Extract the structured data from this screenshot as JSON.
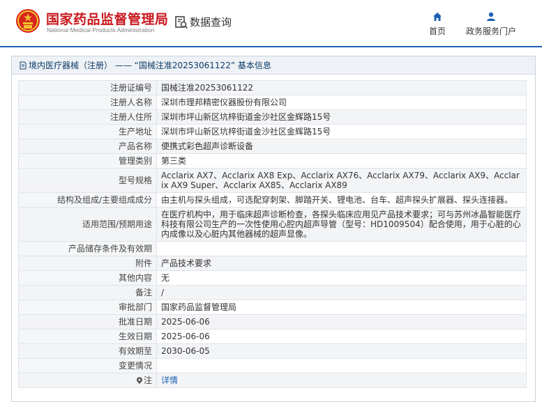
{
  "header": {
    "brand_cn": "国家药品监督管理局",
    "brand_en": "National Medical Products Administration",
    "query_label": "数据查询",
    "nav": [
      {
        "label": "首页",
        "icon": "home-icon"
      },
      {
        "label": "政务服务门户",
        "icon": "user-icon"
      }
    ]
  },
  "panel": {
    "title": "境内医疗器械（注册） —— “国械注准20253061122” 基本信息"
  },
  "rows": [
    {
      "label": "注册证编号",
      "value": "国械注准20253061122"
    },
    {
      "label": "注册人名称",
      "value": "深圳市理邦精密仪器股份有限公司"
    },
    {
      "label": "注册人住所",
      "value": "深圳市坪山新区坑梓街道金沙社区金辉路15号"
    },
    {
      "label": "生产地址",
      "value": "深圳市坪山新区坑梓街道金沙社区金辉路15号"
    },
    {
      "label": "产品名称",
      "value": "便携式彩色超声诊断设备"
    },
    {
      "label": "管理类别",
      "value": "第三类"
    },
    {
      "label": "型号规格",
      "value": "Acclarix AX7、Acclarix AX8 Exp、Acclarix AX76、Acclarix AX79、Acclarix AX9、Acclarix AX9 Super、Acclarix AX85、Acclarix AX89"
    },
    {
      "label": "结构及组成/主要组成成分",
      "value": "由主机与探头组成，可选配穿刺架、脚踏开关、锂电池、台车、超声探头扩展器、探头连接器。"
    },
    {
      "label": "适用范围/预期用途",
      "value": "在医疗机构中，用于临床超声诊断检查，各探头临床应用见产品技术要求；可与苏州冰晶智能医疗科技有限公司生产的一次性使用心腔内超声导管（型号：HD1009504）配合使用，用于心脏的心内成像以及心脏内其他器械的超声显像。"
    },
    {
      "label": "产品储存条件及有效期",
      "value": ""
    },
    {
      "label": "附件",
      "value": "产品技术要求"
    },
    {
      "label": "其他内容",
      "value": "无"
    },
    {
      "label": "备注",
      "value": "/"
    },
    {
      "label": "审批部门",
      "value": "国家药品监督管理局"
    },
    {
      "label": "批准日期",
      "value": "2025-06-06"
    },
    {
      "label": "生效日期",
      "value": "2025-06-06"
    },
    {
      "label": "有效期至",
      "value": "2030-06-05"
    },
    {
      "label": "变更情况",
      "value": ""
    },
    {
      "label": "注",
      "value": "详情",
      "icon": "note-icon"
    }
  ],
  "colors": {
    "brand_red": "#c8171e",
    "brand_blue": "#1d5fb4",
    "title_text": "#0d3a67"
  }
}
